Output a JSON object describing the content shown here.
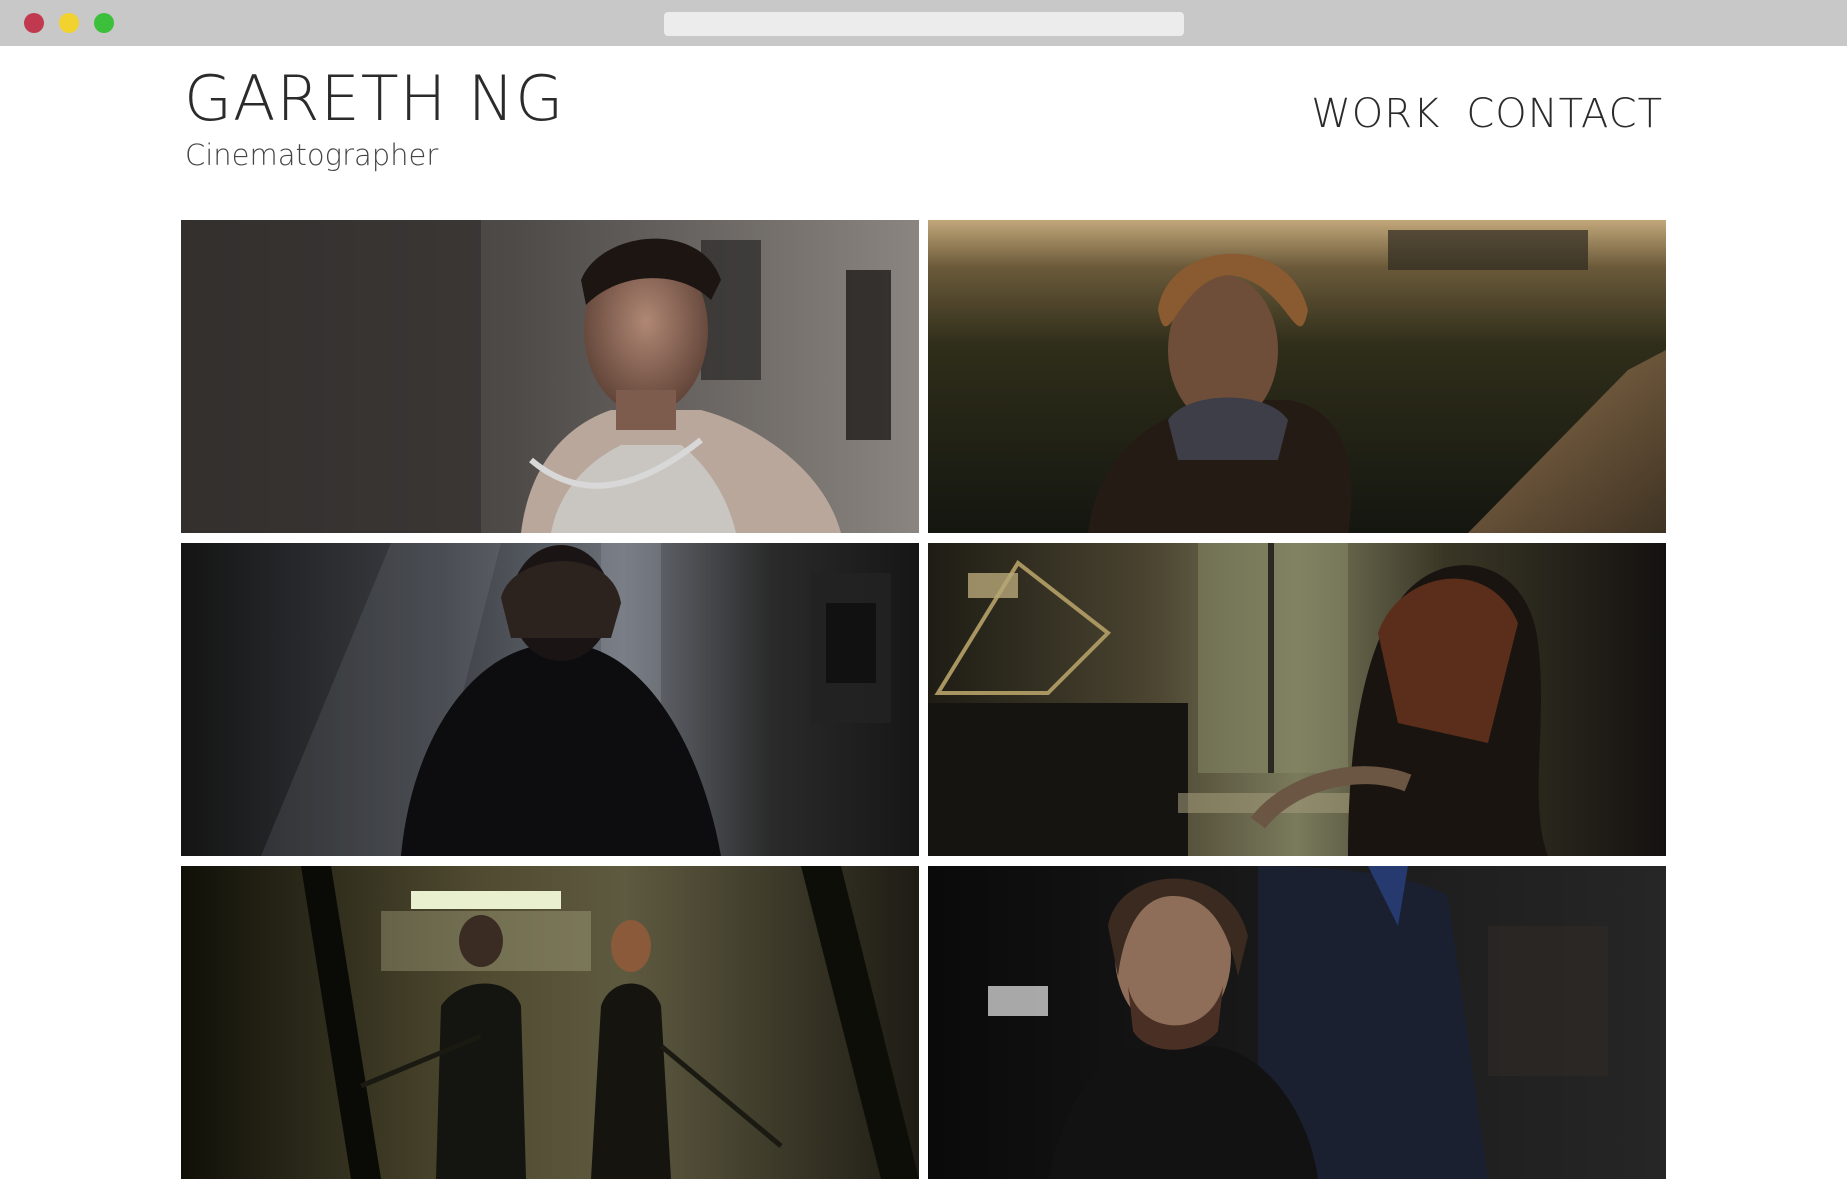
{
  "header": {
    "title": "GARETH NG",
    "subtitle": "Cinematographer"
  },
  "nav": {
    "items": [
      {
        "label": "WORK"
      },
      {
        "label": "CONTACT"
      }
    ]
  },
  "window_controls": {
    "close_color": "#c0394f",
    "minimize_color": "#f2d22f",
    "maximize_color": "#3cbf3a"
  },
  "gallery": {
    "tiles": [
      {
        "subject": "man-in-tank-top-alley"
      },
      {
        "subject": "man-at-sunset-field"
      },
      {
        "subject": "figure-backlit-kitchen"
      },
      {
        "subject": "woman-writing-at-window"
      },
      {
        "subject": "two-people-stairwell"
      },
      {
        "subject": "bearded-man-and-suit"
      }
    ]
  }
}
